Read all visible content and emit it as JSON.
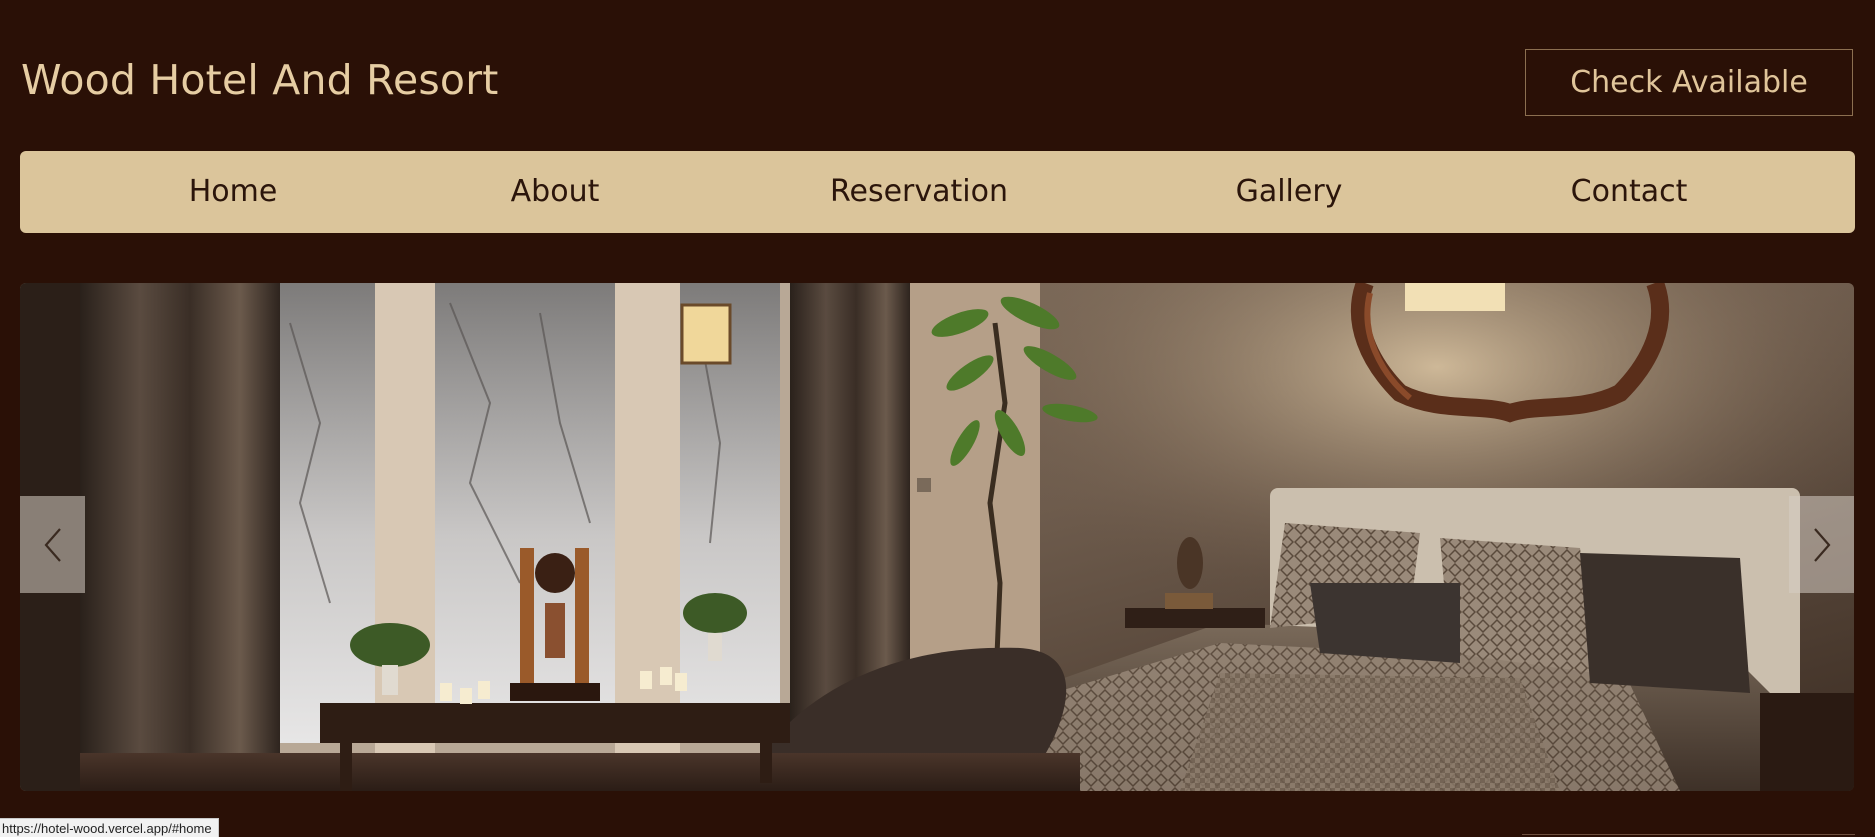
{
  "header": {
    "brand": "Wood Hotel And Resort",
    "cta_label": "Check Available"
  },
  "nav": {
    "items": [
      "Home",
      "About",
      "Reservation",
      "Gallery",
      "Contact"
    ]
  },
  "hero": {
    "image": "hotel-bedroom-photo",
    "prev_icon": "chevron-left-icon",
    "next_icon": "chevron-right-icon"
  },
  "status_bar": {
    "url": "https://hotel-wood.vercel.app/#home"
  },
  "colors": {
    "background": "#2a1006",
    "accent": "#dbc59b",
    "brand_text": "#e6cda3"
  }
}
